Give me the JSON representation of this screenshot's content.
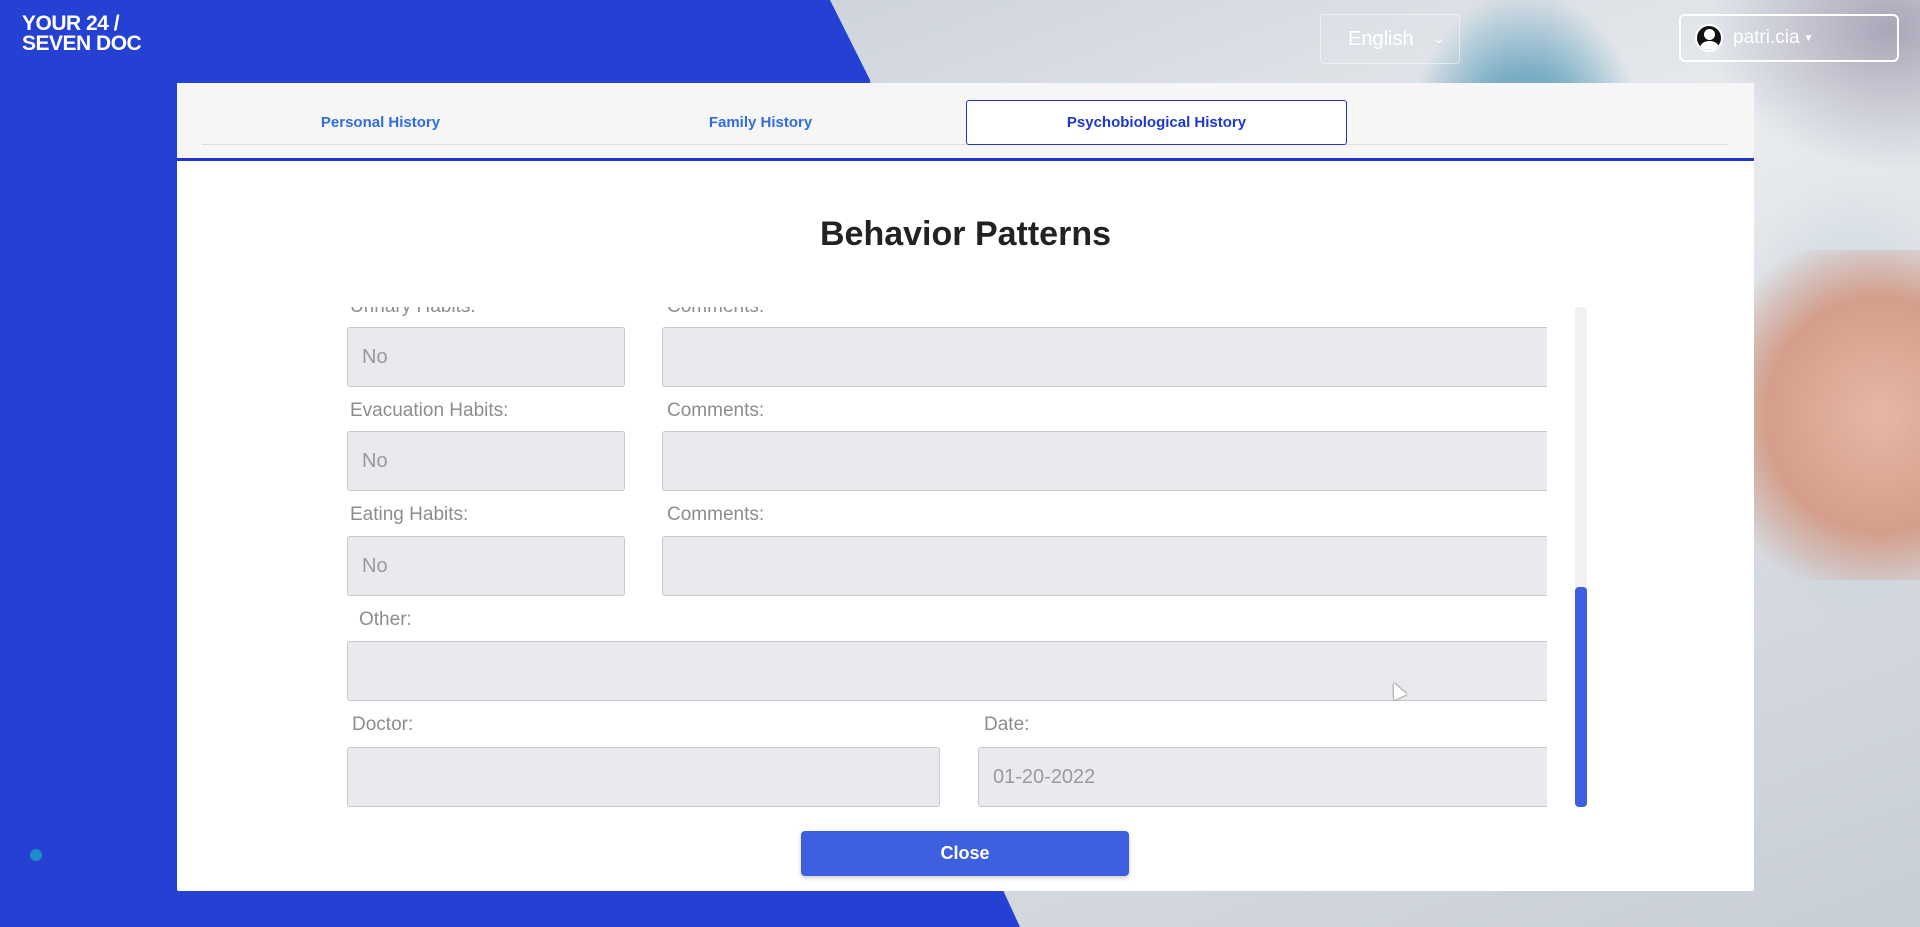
{
  "header": {
    "logo_line1": "YOUR 24 /",
    "logo_line2": "SEVEN DOC",
    "language": "English",
    "username": "patri.cia"
  },
  "tabs": [
    {
      "label": "Personal History",
      "active": false
    },
    {
      "label": "Family History",
      "active": false
    },
    {
      "label": "Psychobiological History",
      "active": true
    }
  ],
  "section_title": "Behavior Patterns",
  "form": {
    "urinary_label": "Urinary Habits:",
    "urinary_value": "No",
    "urinary_comments_label": "Comments:",
    "urinary_comments_value": "",
    "evacuation_label": "Evacuation Habits:",
    "evacuation_value": "No",
    "evacuation_comments_label": "Comments:",
    "evacuation_comments_value": "",
    "eating_label": "Eating Habits:",
    "eating_value": "No",
    "eating_comments_label": "Comments:",
    "eating_comments_value": "",
    "other_label": "Other:",
    "other_value": "",
    "doctor_label": "Doctor:",
    "doctor_value": "",
    "date_label": "Date:",
    "date_value": "01-20-2022"
  },
  "close_label": "Close",
  "colors": {
    "brand_blue": "#2541d4",
    "button_blue": "#3e5fe0",
    "tab_text": "#2f6de0"
  }
}
